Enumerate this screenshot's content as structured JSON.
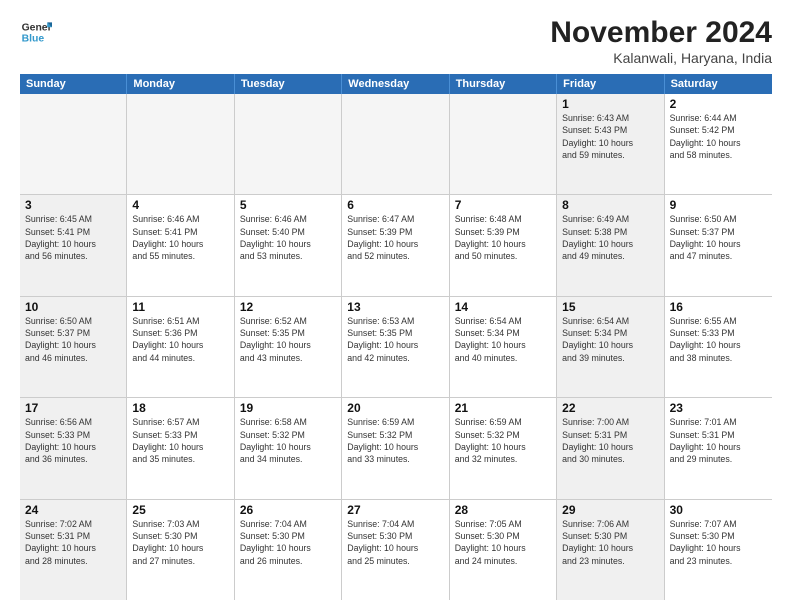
{
  "logo": {
    "text_general": "General",
    "text_blue": "Blue"
  },
  "title": "November 2024",
  "subtitle": "Kalanwali, Haryana, India",
  "days_of_week": [
    "Sunday",
    "Monday",
    "Tuesday",
    "Wednesday",
    "Thursday",
    "Friday",
    "Saturday"
  ],
  "weeks": [
    [
      {
        "day": "",
        "info": "",
        "empty": true
      },
      {
        "day": "",
        "info": "",
        "empty": true
      },
      {
        "day": "",
        "info": "",
        "empty": true
      },
      {
        "day": "",
        "info": "",
        "empty": true
      },
      {
        "day": "",
        "info": "",
        "empty": true
      },
      {
        "day": "1",
        "info": "Sunrise: 6:43 AM\nSunset: 5:43 PM\nDaylight: 10 hours\nand 59 minutes.",
        "shaded": true
      },
      {
        "day": "2",
        "info": "Sunrise: 6:44 AM\nSunset: 5:42 PM\nDaylight: 10 hours\nand 58 minutes.",
        "shaded": false
      }
    ],
    [
      {
        "day": "3",
        "info": "Sunrise: 6:45 AM\nSunset: 5:41 PM\nDaylight: 10 hours\nand 56 minutes.",
        "shaded": true
      },
      {
        "day": "4",
        "info": "Sunrise: 6:46 AM\nSunset: 5:41 PM\nDaylight: 10 hours\nand 55 minutes."
      },
      {
        "day": "5",
        "info": "Sunrise: 6:46 AM\nSunset: 5:40 PM\nDaylight: 10 hours\nand 53 minutes."
      },
      {
        "day": "6",
        "info": "Sunrise: 6:47 AM\nSunset: 5:39 PM\nDaylight: 10 hours\nand 52 minutes."
      },
      {
        "day": "7",
        "info": "Sunrise: 6:48 AM\nSunset: 5:39 PM\nDaylight: 10 hours\nand 50 minutes."
      },
      {
        "day": "8",
        "info": "Sunrise: 6:49 AM\nSunset: 5:38 PM\nDaylight: 10 hours\nand 49 minutes.",
        "shaded": true
      },
      {
        "day": "9",
        "info": "Sunrise: 6:50 AM\nSunset: 5:37 PM\nDaylight: 10 hours\nand 47 minutes."
      }
    ],
    [
      {
        "day": "10",
        "info": "Sunrise: 6:50 AM\nSunset: 5:37 PM\nDaylight: 10 hours\nand 46 minutes.",
        "shaded": true
      },
      {
        "day": "11",
        "info": "Sunrise: 6:51 AM\nSunset: 5:36 PM\nDaylight: 10 hours\nand 44 minutes."
      },
      {
        "day": "12",
        "info": "Sunrise: 6:52 AM\nSunset: 5:35 PM\nDaylight: 10 hours\nand 43 minutes."
      },
      {
        "day": "13",
        "info": "Sunrise: 6:53 AM\nSunset: 5:35 PM\nDaylight: 10 hours\nand 42 minutes."
      },
      {
        "day": "14",
        "info": "Sunrise: 6:54 AM\nSunset: 5:34 PM\nDaylight: 10 hours\nand 40 minutes."
      },
      {
        "day": "15",
        "info": "Sunrise: 6:54 AM\nSunset: 5:34 PM\nDaylight: 10 hours\nand 39 minutes.",
        "shaded": true
      },
      {
        "day": "16",
        "info": "Sunrise: 6:55 AM\nSunset: 5:33 PM\nDaylight: 10 hours\nand 38 minutes."
      }
    ],
    [
      {
        "day": "17",
        "info": "Sunrise: 6:56 AM\nSunset: 5:33 PM\nDaylight: 10 hours\nand 36 minutes.",
        "shaded": true
      },
      {
        "day": "18",
        "info": "Sunrise: 6:57 AM\nSunset: 5:33 PM\nDaylight: 10 hours\nand 35 minutes."
      },
      {
        "day": "19",
        "info": "Sunrise: 6:58 AM\nSunset: 5:32 PM\nDaylight: 10 hours\nand 34 minutes."
      },
      {
        "day": "20",
        "info": "Sunrise: 6:59 AM\nSunset: 5:32 PM\nDaylight: 10 hours\nand 33 minutes."
      },
      {
        "day": "21",
        "info": "Sunrise: 6:59 AM\nSunset: 5:32 PM\nDaylight: 10 hours\nand 32 minutes."
      },
      {
        "day": "22",
        "info": "Sunrise: 7:00 AM\nSunset: 5:31 PM\nDaylight: 10 hours\nand 30 minutes.",
        "shaded": true
      },
      {
        "day": "23",
        "info": "Sunrise: 7:01 AM\nSunset: 5:31 PM\nDaylight: 10 hours\nand 29 minutes."
      }
    ],
    [
      {
        "day": "24",
        "info": "Sunrise: 7:02 AM\nSunset: 5:31 PM\nDaylight: 10 hours\nand 28 minutes.",
        "shaded": true
      },
      {
        "day": "25",
        "info": "Sunrise: 7:03 AM\nSunset: 5:30 PM\nDaylight: 10 hours\nand 27 minutes."
      },
      {
        "day": "26",
        "info": "Sunrise: 7:04 AM\nSunset: 5:30 PM\nDaylight: 10 hours\nand 26 minutes."
      },
      {
        "day": "27",
        "info": "Sunrise: 7:04 AM\nSunset: 5:30 PM\nDaylight: 10 hours\nand 25 minutes."
      },
      {
        "day": "28",
        "info": "Sunrise: 7:05 AM\nSunset: 5:30 PM\nDaylight: 10 hours\nand 24 minutes."
      },
      {
        "day": "29",
        "info": "Sunrise: 7:06 AM\nSunset: 5:30 PM\nDaylight: 10 hours\nand 23 minutes.",
        "shaded": true
      },
      {
        "day": "30",
        "info": "Sunrise: 7:07 AM\nSunset: 5:30 PM\nDaylight: 10 hours\nand 23 minutes."
      }
    ]
  ]
}
